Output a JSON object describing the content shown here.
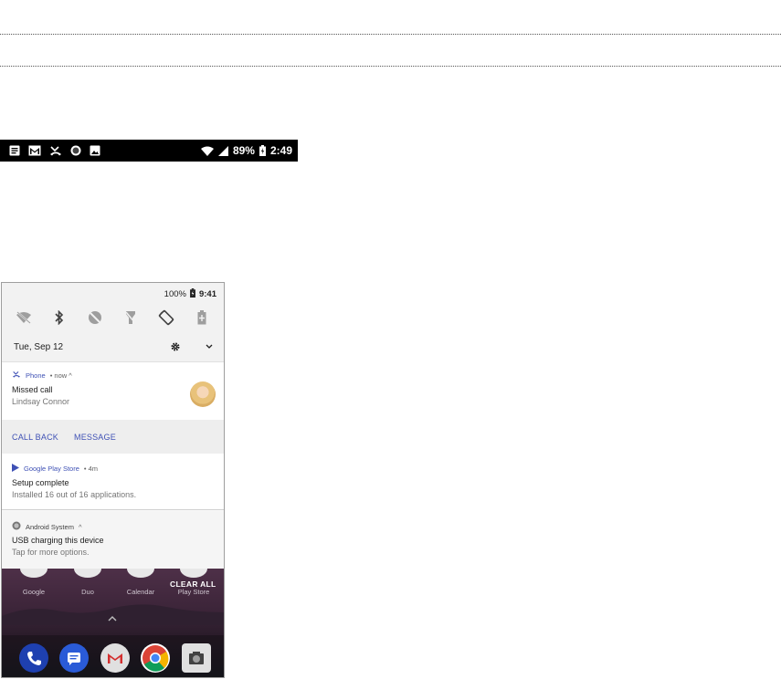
{
  "statusbar": {
    "battery": "89%",
    "time": "2:49",
    "icons": [
      "notes-icon",
      "gmail-icon",
      "missed-call-icon",
      "circle-icon",
      "image-icon",
      "wifi-icon",
      "signal-icon",
      "battery-charging-icon"
    ]
  },
  "shade": {
    "battery": "100%",
    "time": "9:41",
    "quick_settings": [
      "wifi-off-icon",
      "bluetooth-icon",
      "dnd-icon",
      "flashlight-icon",
      "auto-rotate-icon",
      "battery-saver-icon"
    ],
    "date": "Tue, Sep 12"
  },
  "notifications": {
    "phone": {
      "app": "Phone",
      "meta": "• now ^",
      "title": "Missed call",
      "subtitle": "Lindsay Connor",
      "actions": [
        "CALL BACK",
        "MESSAGE"
      ]
    },
    "play": {
      "app": "Google Play Store",
      "meta": "• 4m",
      "title": "Setup complete",
      "subtitle": "Installed 16 out of 16 applications."
    },
    "system": {
      "app": "Android System",
      "meta": "^",
      "title": "USB charging this device",
      "subtitle": "Tap for more options."
    }
  },
  "home": {
    "apps": [
      "Google",
      "Duo",
      "Calendar",
      "Play Store"
    ],
    "clear_all": "CLEAR ALL",
    "dock": [
      "phone-app-icon",
      "messages-app-icon",
      "gmail-app-icon",
      "chrome-app-icon",
      "camera-app-icon"
    ]
  },
  "colors": {
    "accent": "#3f51b5",
    "statusbar_bg": "#000000",
    "action_bar_bg": "#eeeeee"
  }
}
